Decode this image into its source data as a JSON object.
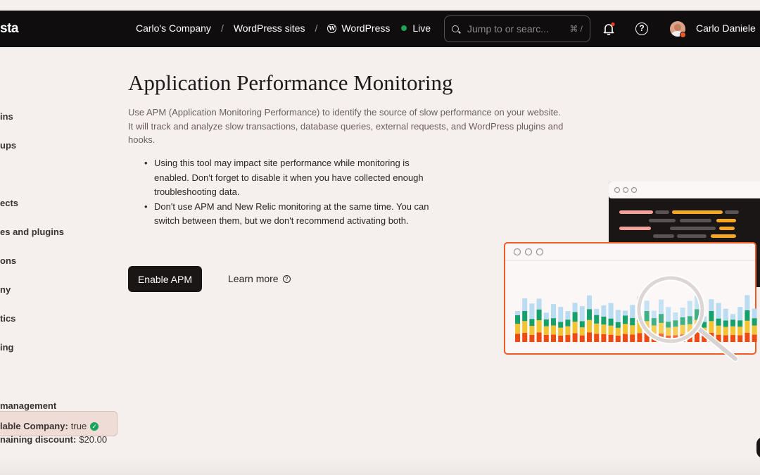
{
  "navbar": {
    "logo": "sta",
    "breadcrumb": [
      "Carlo's Company",
      "WordPress sites",
      "WordPress"
    ],
    "separator": "/",
    "status": "Live",
    "search_placeholder": "Jump to or searc...",
    "search_shortcut": "⌘ /",
    "help_glyph": "?",
    "user_name": "Carlo Daniele",
    "notification_dot_color": "#ef3b2d",
    "status_color": "#1aa35a"
  },
  "sidebar": {
    "items": [
      "ins",
      "ups",
      "ects",
      "es and plugins",
      "ons",
      "ny",
      "tics",
      "ing",
      "management"
    ],
    "affiliate": {
      "label1": "lable Company:",
      "value1": "true",
      "label2": "naining discount:",
      "value2": "$20.00"
    }
  },
  "main": {
    "title": "Application Performance Monitoring",
    "description": "Use APM (Application Monitoring Performance) to identify the source of slow performance on your website. It will track and analyze slow transactions, database queries, external requests, and WordPress plugins and hooks.",
    "bullets": [
      "Using this tool may impact site performance while monitoring is enabled. Don't forget to disable it when you have collected enough troubleshooting data.",
      "Don't use APM and New Relic monitoring at the same time. You can switch between them, but we don't recommend activating both."
    ],
    "enable_button": "Enable APM",
    "learn_more": "Learn more",
    "learn_more_icon": "question-circle-icon"
  },
  "colors": {
    "brand_dark": "#0f0d0d",
    "accent_orange": "#ef5a25",
    "bar_red": "#f04a14",
    "bar_yellow": "#f2c432",
    "bar_green": "#16a06b",
    "bar_blue": "#b9dcf2"
  }
}
